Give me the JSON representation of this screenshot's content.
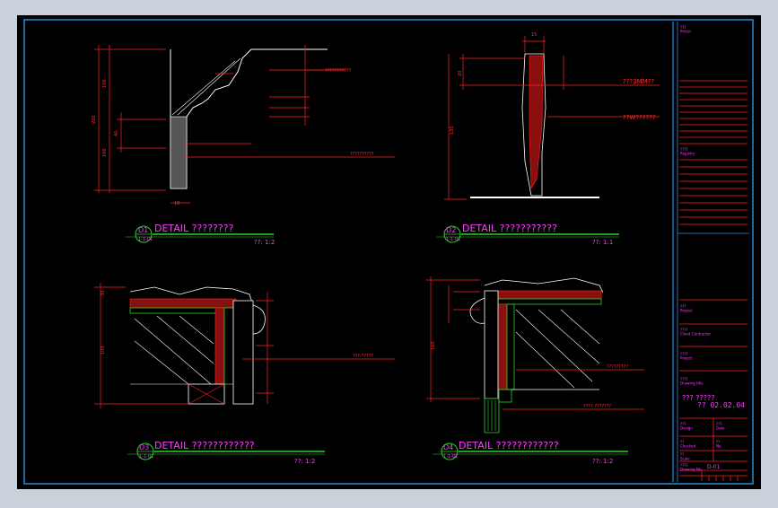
{
  "colors": {
    "background": "#000000",
    "border": "#2a8bd6",
    "frame_outer": "#c9d2db",
    "line_red": "#ff2020",
    "line_white": "#ffffff",
    "line_green": "#28d428",
    "text_magenta": "#ff3cff",
    "text_red": "#ff3030"
  },
  "details": [
    {
      "id": "D1",
      "ref": "1-1-01",
      "title": "DETAIL  ????????",
      "scale": "??: 1:2"
    },
    {
      "id": "D2",
      "ref": "1-1-01",
      "title": "DETAIL  ???????????",
      "scale": "??: 1:1"
    },
    {
      "id": "D3",
      "ref": "1-1-01",
      "title": "DETAIL  ????????????",
      "scale": "??: 1:2"
    },
    {
      "id": "D4",
      "ref": "1-1-01",
      "title": "DETAIL  ????????????",
      "scale": "??: 1:2"
    }
  ],
  "callouts": {
    "d1_a": "???????????",
    "d1_b": "??????????",
    "d2_a": "???3MM??",
    "d2_b": "??W??????",
    "d3_a": "???-?????",
    "d4_a": "?????????",
    "d4_b": "????-???????"
  },
  "dims": {
    "d1_left_total": "200",
    "d1_left_a": "100",
    "d1_left_b": "40",
    "d1_left_c": "100",
    "d1_small": "18",
    "d2_top": "15",
    "d2_a": "20",
    "d2_b": "135",
    "d3_a": "30",
    "d3_b": "100",
    "d4_a": "160"
  },
  "title_block": {
    "field_1": "???\nPrtner",
    "field_2": "????\nRegistry",
    "field_3": "???\nProject",
    "field_4": "????\nClient Contractor",
    "field_5": "????\nProject",
    "field_6": "????\nDrawing title",
    "drawing_title": "??? ?????",
    "drawing_id": "?? 02.02.04",
    "field_7": "???\nDesign",
    "field_8": "???\nDate",
    "field_9": "??\nChecked",
    "field_10": "??\nNo",
    "field_11": "??\nScale",
    "drawing_no_label": "????\nDrawing No.",
    "drawing_no": "D-01"
  }
}
